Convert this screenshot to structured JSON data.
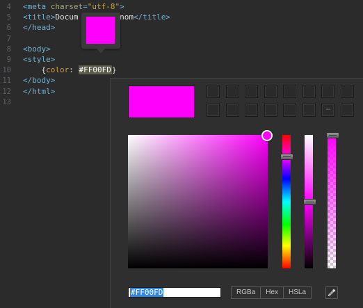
{
  "editor": {
    "line_numbers": [
      "4",
      "5",
      "6",
      "7",
      "8",
      "9",
      "10",
      "11",
      "12",
      "13"
    ],
    "lines": [
      {
        "parts": [
          {
            "cls": "tag",
            "t": "<meta "
          },
          {
            "cls": "attr",
            "t": "charset"
          },
          {
            "cls": "tag",
            "t": "="
          },
          {
            "cls": "str",
            "t": "\"utf-8\""
          },
          {
            "cls": "tag",
            "t": ">"
          }
        ]
      },
      {
        "parts": [
          {
            "cls": "tag",
            "t": "<title>"
          },
          {
            "cls": "txt",
            "t": "Docum       s nom"
          },
          {
            "cls": "tag",
            "t": "</title>"
          }
        ]
      },
      {
        "parts": [
          {
            "cls": "tag",
            "t": "</head>"
          }
        ]
      },
      {
        "parts": []
      },
      {
        "parts": [
          {
            "cls": "tag",
            "t": "<body>"
          }
        ]
      },
      {
        "parts": [
          {
            "cls": "tag",
            "t": "<style>"
          }
        ]
      },
      {
        "parts": [
          {
            "cls": "txt",
            "t": "    {"
          },
          {
            "cls": "prop",
            "t": "color"
          },
          {
            "cls": "txt",
            "t": ": "
          },
          {
            "cls": "sel",
            "t": "#FF00FD"
          },
          {
            "cls": "txt",
            "t": "}"
          }
        ]
      },
      {
        "parts": [
          {
            "cls": "tag",
            "t": "</body>"
          }
        ]
      },
      {
        "parts": [
          {
            "cls": "tag",
            "t": "</html>"
          }
        ]
      },
      {
        "parts": []
      }
    ]
  },
  "preview": {
    "color": "#FF00FD"
  },
  "picker": {
    "current_color": "#FF00FD",
    "saturation_value": {
      "saturation": 1.0,
      "brightness": 1.0
    },
    "hue_level": 0.84,
    "lightness_level": 0.5,
    "alpha_level": 1.0,
    "hex_value": "#FF00FD",
    "modes": [
      "RGBa",
      "Hex",
      "HSLa"
    ],
    "swatches_empty": 16,
    "eyedropper_icon": "eyedropper-icon",
    "more_icon": "ellipsis-icon"
  }
}
